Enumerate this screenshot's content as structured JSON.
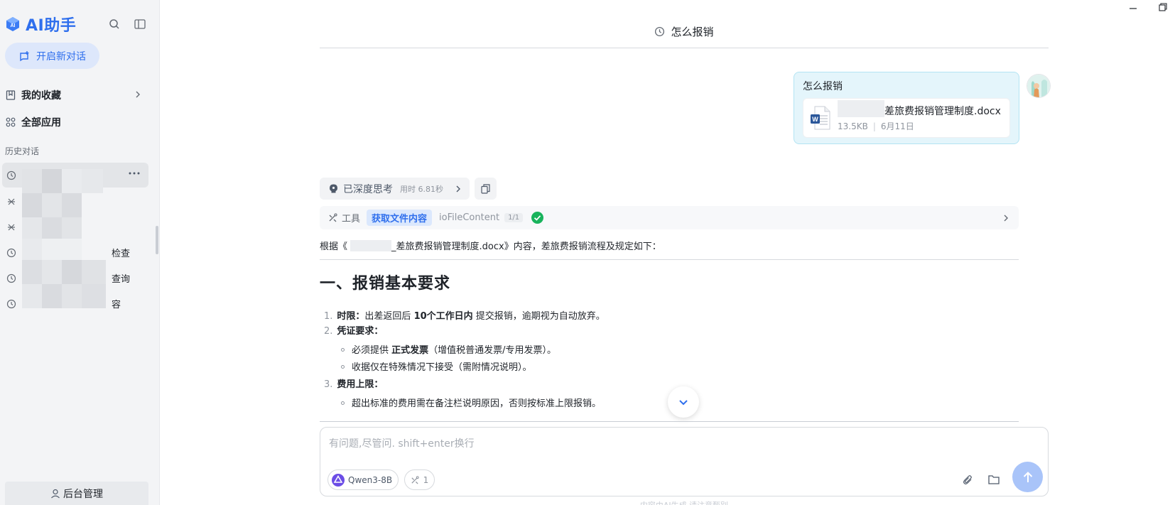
{
  "app": {
    "logo_text": "AI助手",
    "new_chat_label": "开启新对话",
    "favorites_label": "我的收藏",
    "all_apps_label": "全部应用",
    "history_title": "历史对话",
    "admin_label": "后台管理"
  },
  "history": [
    {
      "suffix": "",
      "icon": "clock-icon"
    },
    {
      "suffix": "",
      "icon": "tools-icon"
    },
    {
      "suffix": "",
      "icon": "tools-icon"
    },
    {
      "suffix": "检查",
      "icon": "clock-icon"
    },
    {
      "suffix": "查询",
      "icon": "clock-icon"
    },
    {
      "suffix": "容",
      "icon": "clock-icon"
    }
  ],
  "conversation": {
    "title": "怎么报销",
    "user_message": "怎么报销",
    "file": {
      "name": "差旅费报销管理制度.docx",
      "size": "13.5KB",
      "date": "6月11日"
    },
    "thinking": {
      "label": "已深度思考",
      "time": "用时 6.81秒"
    },
    "tool": {
      "label": "工具",
      "tag": "获取文件内容",
      "name": "ioFileContent",
      "count": "1/1"
    },
    "answer_intro_prefix": "根据《",
    "answer_intro_suffix": "_差旅费报销管理制度.docx》内容，差旅费报销流程及规定如下：",
    "heading": "一、报销基本要求",
    "items": [
      {
        "num": "1.",
        "strong_label": "时限：",
        "pre": "出差返回后 ",
        "strong": "10个工作日内",
        "post": " 提交报销，逾期视为自动放弃。"
      },
      {
        "num": "2.",
        "strong_label": "凭证要求：",
        "pre": "",
        "strong": "",
        "post": ""
      },
      {
        "num": "3.",
        "strong_label": "费用上限：",
        "pre": "",
        "strong": "",
        "post": ""
      }
    ],
    "sub_items": [
      {
        "pre": "必须提供 ",
        "strong": "正式发票",
        "post": "（增值税普通发票/专用发票）。"
      },
      {
        "pre": "收据仅在特殊情况下接受（需附情况说明）。",
        "strong": "",
        "post": ""
      },
      {
        "pre": "超出标准的费用需在备注栏说明原因，否则按标准上限报销。",
        "strong": "",
        "post": ""
      }
    ]
  },
  "composer": {
    "placeholder": "有问题,尽管问. shift+enter换行",
    "model": "Qwen3-8B",
    "tools_count": "1",
    "footer": "内容由AI生成 请注意甄别"
  },
  "colors": {
    "accent": "#2f6fed",
    "sidebar_bg": "#f3f4f6",
    "user_bubble_bg": "#e4f5fb",
    "send_button": "#a9c4f9",
    "success": "#19b35c"
  }
}
